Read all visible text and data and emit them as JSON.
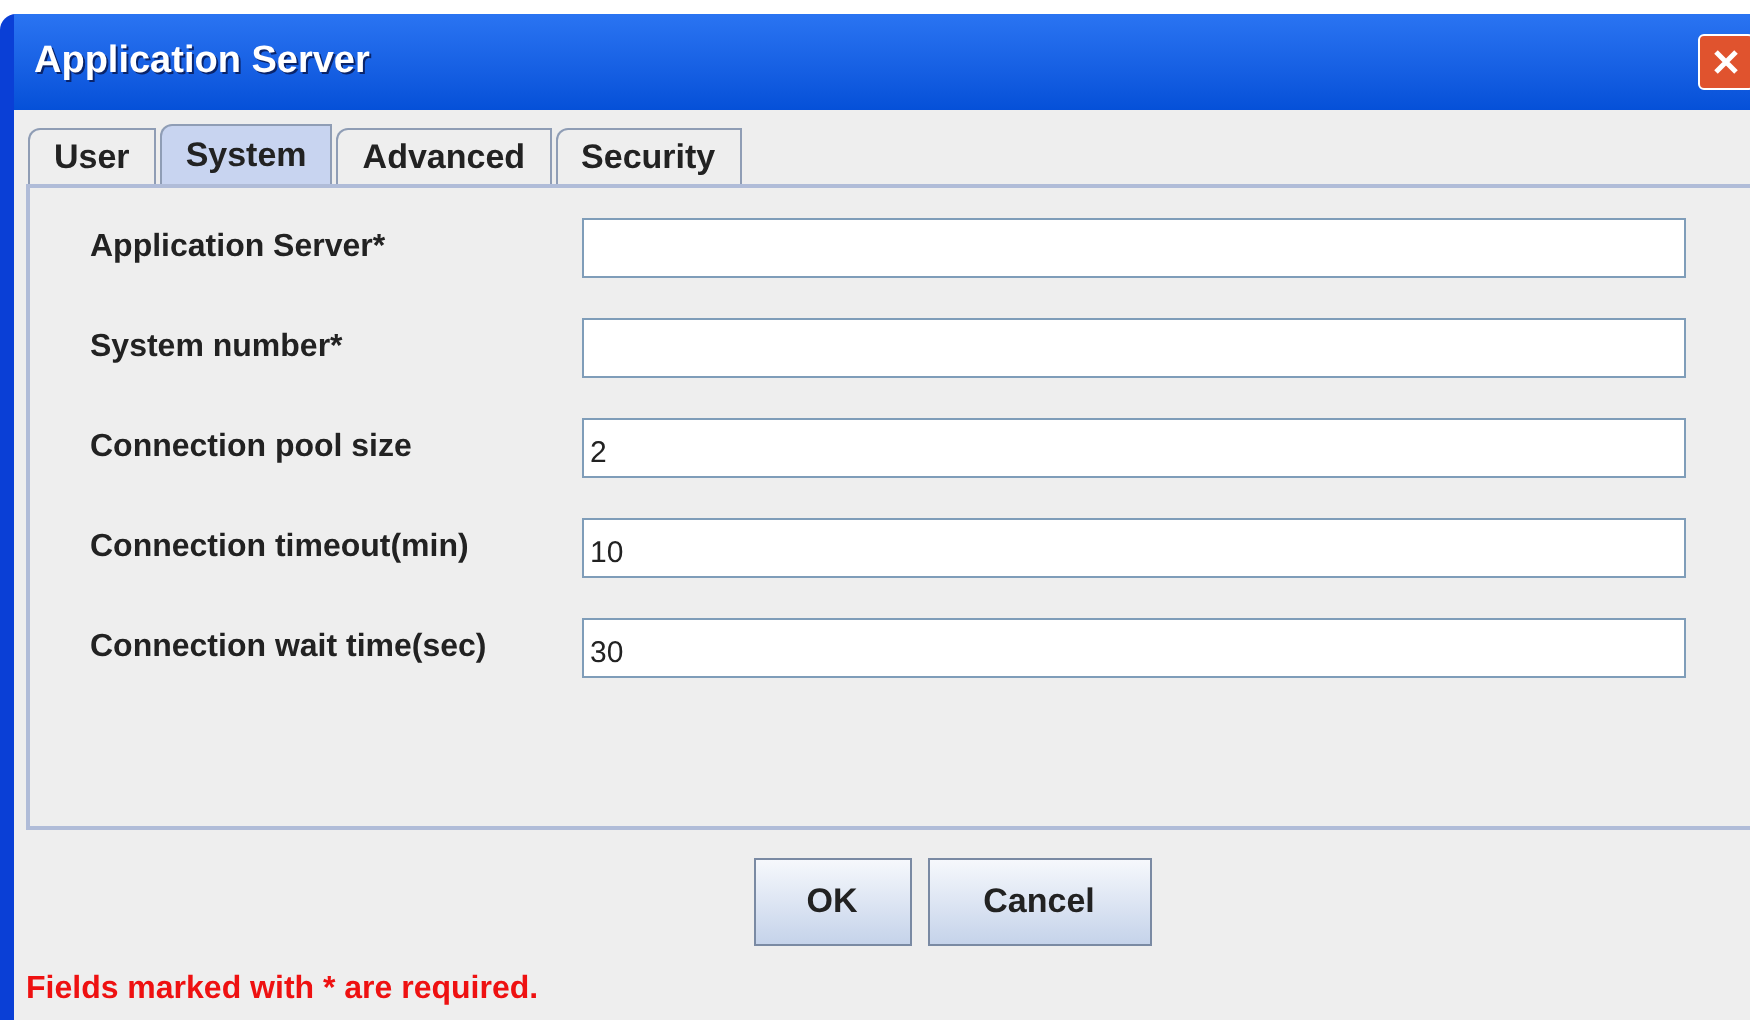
{
  "window": {
    "title": "Application Server"
  },
  "tabs": [
    {
      "label": "User",
      "selected": false
    },
    {
      "label": "System",
      "selected": true
    },
    {
      "label": "Advanced",
      "selected": false
    },
    {
      "label": "Security",
      "selected": false
    }
  ],
  "fields": [
    {
      "label": "Application Server*"
    },
    {
      "label": "System number*"
    },
    {
      "label": "Connection pool size",
      "value": "2"
    },
    {
      "label": "Connection timeout(min)",
      "value": "10"
    },
    {
      "label": "Connection wait time(sec)",
      "value": "30"
    }
  ],
  "buttons": [
    "OK",
    "Cancel"
  ],
  "note": "Fields marked with * are required."
}
